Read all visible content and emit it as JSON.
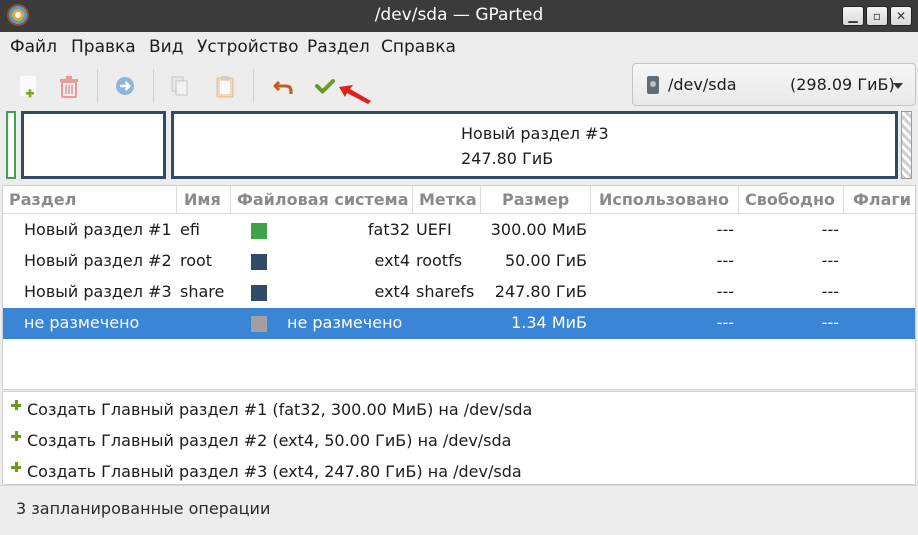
{
  "window": {
    "title": "/dev/sda — GParted"
  },
  "menu": [
    "Файл",
    "Правка",
    "Вид",
    "Устройство",
    "Раздел",
    "Справка"
  ],
  "toolbar": {
    "icons": [
      "new-partition",
      "delete-partition",
      "resize-move",
      "copy",
      "paste",
      "undo",
      "apply"
    ]
  },
  "device": {
    "name": "/dev/sda",
    "size": "(298.09 ГиБ)"
  },
  "diskmap": {
    "big_label": "Новый раздел #3",
    "big_size": "247.80 ГиБ"
  },
  "columns": [
    "Раздел",
    "Имя",
    "Файловая система",
    "Метка",
    "Размер",
    "Использовано",
    "Свободно",
    "Флаги"
  ],
  "rows": [
    {
      "partition": "Новый раздел #1",
      "name": "efi",
      "fs": "fat32",
      "label": "UEFI",
      "size": "300.00 МиБ",
      "used": "---",
      "free": "---",
      "color": "#3fa34d",
      "selected": false
    },
    {
      "partition": "Новый раздел #2",
      "name": "root",
      "fs": "ext4",
      "label": "rootfs",
      "size": "50.00 ГиБ",
      "used": "---",
      "free": "---",
      "color": "#2f4b68",
      "selected": false
    },
    {
      "partition": "Новый раздел #3",
      "name": "share",
      "fs": "ext4",
      "label": "sharefs",
      "size": "247.80 ГиБ",
      "used": "---",
      "free": "---",
      "color": "#2f4b68",
      "selected": false
    },
    {
      "partition": "не размечено",
      "name": "",
      "fs": "не размечено",
      "label": "",
      "size": "1.34 МиБ",
      "used": "---",
      "free": "---",
      "color": "#a0a0a0",
      "selected": true
    }
  ],
  "operations": [
    "Создать Главный раздел #1 (fat32, 300.00 МиБ) на /dev/sda",
    "Создать Главный раздел #2 (ext4, 50.00 ГиБ) на /dev/sda",
    "Создать Главный раздел #3 (ext4, 247.80 ГиБ) на /dev/sda"
  ],
  "status": "3 запланированные операции",
  "colors": {
    "selection": "#3a85d6",
    "accent_green": "#6a9a1f",
    "undo": "#c75a1c",
    "arrow": "#e0201a"
  }
}
